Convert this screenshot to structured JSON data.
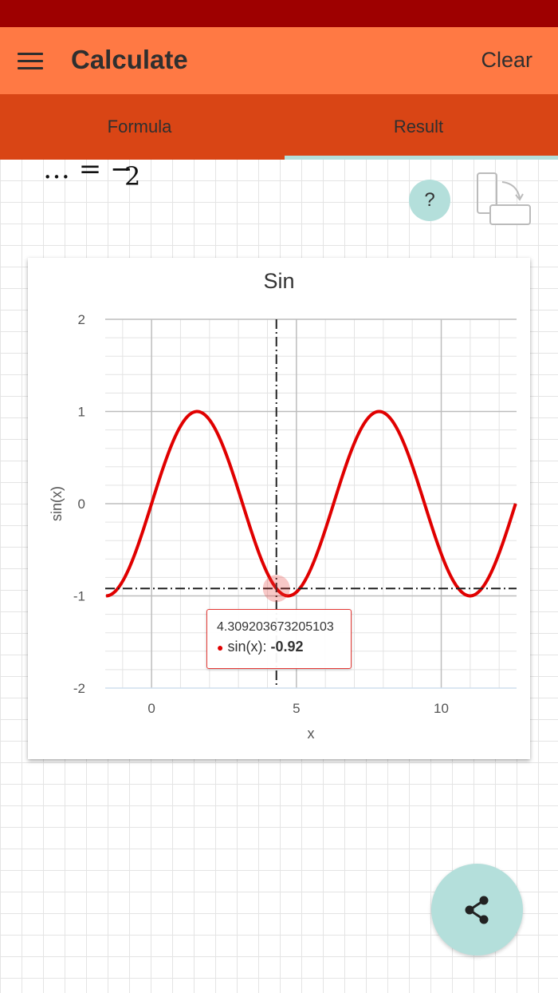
{
  "app_bar": {
    "title": "Calculate",
    "clear_label": "Clear",
    "menu_icon": "menu-icon"
  },
  "tabs": [
    {
      "label": "Formula",
      "selected": false
    },
    {
      "label": "Result",
      "selected": true
    }
  ],
  "formula": {
    "dots": "… = −",
    "denominator": "2"
  },
  "help": {
    "label": "?"
  },
  "icons": {
    "rotate": "rotate-device-icon",
    "share": "share-icon"
  },
  "colors": {
    "status_bar": "#9e0000",
    "app_bar": "#ff7944",
    "tabs": "#d94515",
    "accent": "#b4dfdb",
    "curve": "#e00000"
  },
  "chart_data": {
    "type": "line",
    "title": "Sin",
    "xlabel": "x",
    "ylabel": "sin(x)",
    "xlim": [
      -1.6,
      12.6
    ],
    "ylim": [
      -2,
      2
    ],
    "x_ticks": [
      0,
      5,
      10
    ],
    "y_ticks": [
      2,
      1,
      0,
      -1,
      -2
    ],
    "grid": true,
    "series": [
      {
        "name": "sin(x)",
        "function": "sin(x)",
        "x_range": [
          -1.5708,
          12.5664
        ],
        "color": "#e00000"
      }
    ],
    "crosshair": {
      "x": 4.309203673205103,
      "y": -0.92
    },
    "tooltip": {
      "x_text": "4.309203673205103",
      "series_label": "sin(x):",
      "value_text": "-0.92"
    }
  }
}
